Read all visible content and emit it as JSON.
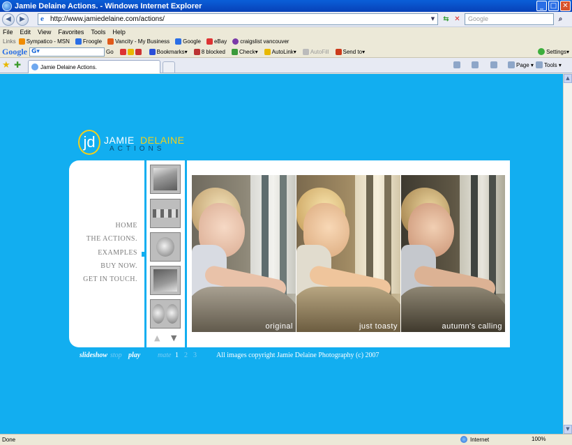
{
  "window": {
    "title": "Jamie Delaine Actions. - Windows Internet Explorer",
    "minimize": "_",
    "maximize": "□",
    "close": "✕"
  },
  "address": {
    "url": "http://www.jamiedelaine.com/actions/",
    "search_placeholder": "Google"
  },
  "menu": [
    "File",
    "Edit",
    "View",
    "Favorites",
    "Tools",
    "Help"
  ],
  "links_bar": {
    "label": "Links",
    "items": [
      {
        "label": "Sympatico - MSN",
        "color": "#f08c00"
      },
      {
        "label": "Froogle",
        "color": "#2a6ee6"
      },
      {
        "label": "Vancity - My Business",
        "color": "#e05a1a"
      },
      {
        "label": "Google",
        "color": "#2a6ee6"
      },
      {
        "label": "eBay",
        "color": "#d33"
      },
      {
        "label": "craigslist vancouver",
        "color": "#7a3aa8"
      }
    ]
  },
  "google_bar": {
    "logo": "Google",
    "box_value": "G▾",
    "go": "Go",
    "bookmarks": "Bookmarks▾",
    "blocked": "8 blocked",
    "check": "Check▾",
    "autolink": "AutoLink▾",
    "autofill": "AutoFill",
    "sendto": "Send to▾",
    "settings": "Settings▾"
  },
  "tabs": {
    "active_tab": "Jamie Delaine Actions.",
    "page_cmd": "Page ▾",
    "tools_cmd": "Tools ▾"
  },
  "site": {
    "logo_mark": "jd",
    "logo_first": "JAMIE",
    "logo_last": "DELAINE",
    "logo_sub": "ACTIONS",
    "nav": [
      "HOME",
      "THE ACTIONS.",
      "EXAMPLES",
      "BUY NOW.",
      "GET IN TOUCH."
    ],
    "thumb_nav": {
      "up": "▲",
      "down": "▼"
    },
    "photos": [
      {
        "caption": "original"
      },
      {
        "caption": "just toasty"
      },
      {
        "caption": "autumn's calling"
      }
    ],
    "footer": {
      "slideshow": "slideshow",
      "stop": "stop",
      "play": "play",
      "mate": "mate",
      "page1": "1",
      "page2": "2",
      "page3": "3",
      "copyright": "All images copyright Jamie Delaine Photography (c) 2007"
    },
    "colors": {
      "background": "#12aef0",
      "accent_yellow": "#f4d01a"
    }
  },
  "status": {
    "text": "Done",
    "zone": "Internet",
    "zoom": "100%"
  }
}
